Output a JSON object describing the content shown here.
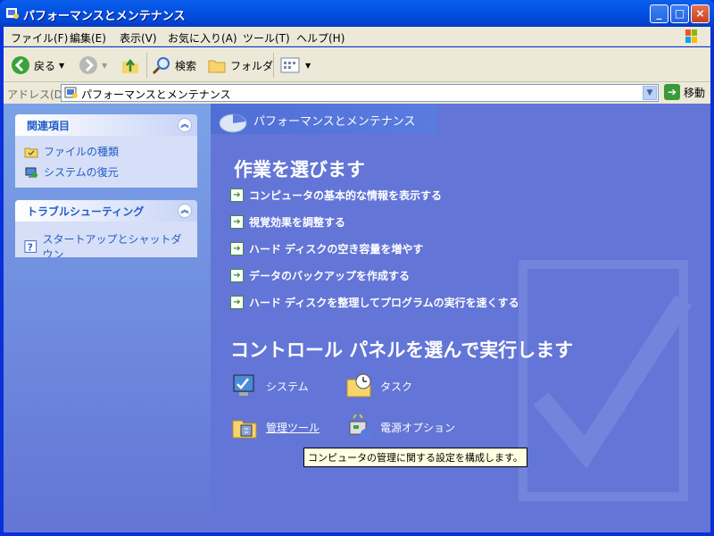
{
  "window": {
    "title": "パフォーマンスとメンテナンス",
    "minimize": "_",
    "maximize": "□",
    "close": "×"
  },
  "menubar": {
    "items": [
      "ファイル(F)",
      "編集(E)",
      "表示(V)",
      "お気に入り(A)",
      "ツール(T)",
      "ヘルプ(H)"
    ]
  },
  "toolbar": {
    "back": "戻る",
    "search": "検索",
    "folders": "フォルダ"
  },
  "address": {
    "label": "アドレス(D)",
    "value": "パフォーマンスとメンテナンス",
    "go": "移動"
  },
  "sidebar": {
    "related": {
      "title": "関連項目",
      "items": [
        "ファイルの種類",
        "システムの復元"
      ]
    },
    "troubleshoot": {
      "title": "トラブルシューティング",
      "items": [
        "スタートアップとシャットダウン"
      ]
    }
  },
  "main": {
    "category": "パフォーマンスとメンテナンス",
    "pick_task": "作業を選びます",
    "tasks": [
      "コンピュータの基本的な情報を表示する",
      "視覚効果を調整する",
      "ハード ディスクの空き容量を増やす",
      "データのバックアップを作成する",
      "ハード ディスクを整理してプログラムの実行を速くする"
    ],
    "pick_cp": "コントロール パネルを選んで実行します",
    "cp_items": [
      "システム",
      "タスク",
      "管理ツール",
      "電源オプション"
    ],
    "tooltip": "コンピュータの管理に関する設定を構成します。"
  },
  "colors": {
    "title_blue": "#0353E4",
    "content_blue": "#6375D6",
    "link_blue": "#215DC6"
  }
}
